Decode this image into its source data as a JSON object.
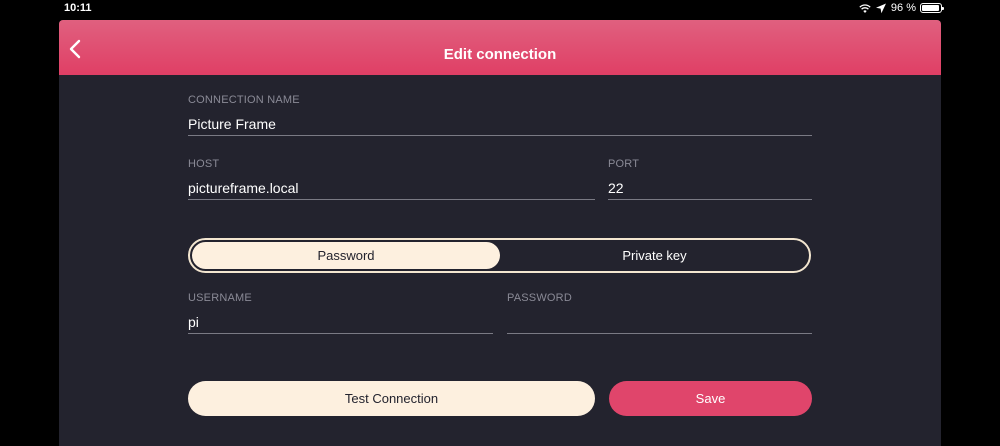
{
  "status_bar": {
    "time": "10:11",
    "battery": "96 %",
    "icons": [
      "wifi-icon",
      "location-icon",
      "battery-icon"
    ]
  },
  "nav": {
    "title": "Edit connection",
    "back_icon": "chevron-left-icon"
  },
  "form": {
    "connection_name": {
      "label": "CONNECTION NAME",
      "value": "Picture Frame"
    },
    "host": {
      "label": "HOST",
      "value": "pictureframe.local"
    },
    "port": {
      "label": "PORT",
      "value": "22"
    },
    "auth": {
      "options": [
        "Password",
        "Private key"
      ],
      "selected": "Password"
    },
    "username": {
      "label": "USERNAME",
      "value": "pi"
    },
    "password": {
      "label": "PASSWORD",
      "value": ""
    }
  },
  "actions": {
    "test_label": "Test Connection",
    "save_label": "Save"
  },
  "colors": {
    "accent": "#e0456b",
    "background": "#23232e",
    "cream": "#fdf0df"
  }
}
